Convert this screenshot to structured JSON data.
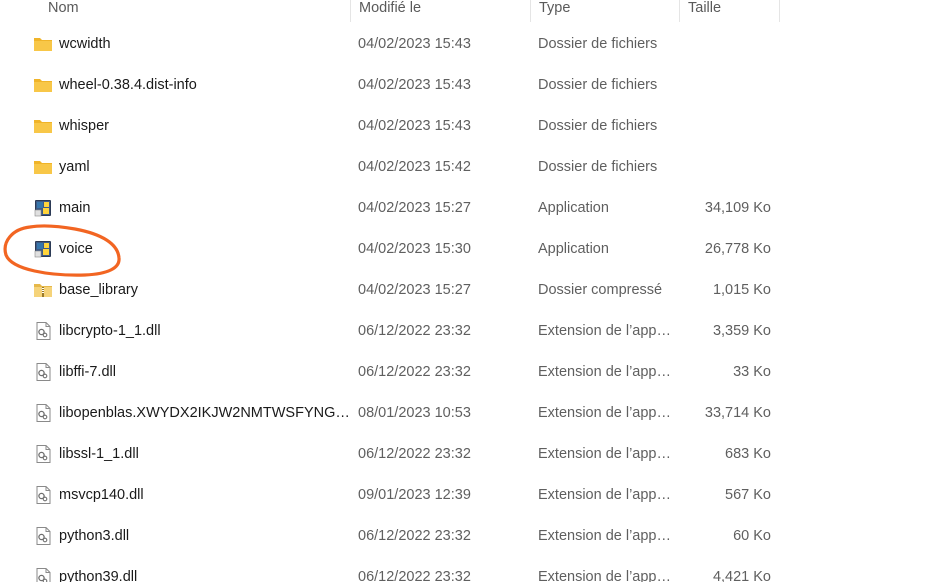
{
  "columns": {
    "name": "Nom",
    "modified": "Modifié le",
    "type": "Type",
    "size": "Taille"
  },
  "files": [
    {
      "name": "wcwidth",
      "modified": "04/02/2023 15:43",
      "type": "Dossier de fichiers",
      "size": "",
      "icon": "folder-icon"
    },
    {
      "name": "wheel-0.38.4.dist-info",
      "modified": "04/02/2023 15:43",
      "type": "Dossier de fichiers",
      "size": "",
      "icon": "folder-icon"
    },
    {
      "name": "whisper",
      "modified": "04/02/2023 15:43",
      "type": "Dossier de fichiers",
      "size": "",
      "icon": "folder-icon"
    },
    {
      "name": "yaml",
      "modified": "04/02/2023 15:42",
      "type": "Dossier de fichiers",
      "size": "",
      "icon": "folder-icon"
    },
    {
      "name": "main",
      "modified": "04/02/2023 15:27",
      "type": "Application",
      "size": "34,109 Ko",
      "icon": "python-app-icon"
    },
    {
      "name": "voice",
      "modified": "04/02/2023 15:30",
      "type": "Application",
      "size": "26,778 Ko",
      "icon": "python-app-icon"
    },
    {
      "name": "base_library",
      "modified": "04/02/2023 15:27",
      "type": "Dossier compressé",
      "size": "1,015 Ko",
      "icon": "zip-folder-icon"
    },
    {
      "name": "libcrypto-1_1.dll",
      "modified": "06/12/2022 23:32",
      "type": "Extension de l’app…",
      "size": "3,359 Ko",
      "icon": "dll-file-icon"
    },
    {
      "name": "libffi-7.dll",
      "modified": "06/12/2022 23:32",
      "type": "Extension de l’app…",
      "size": "33 Ko",
      "icon": "dll-file-icon"
    },
    {
      "name": "libopenblas.XWYDX2IKJW2NMTWSFYNG…",
      "modified": "08/01/2023 10:53",
      "type": "Extension de l’app…",
      "size": "33,714 Ko",
      "icon": "dll-file-icon"
    },
    {
      "name": "libssl-1_1.dll",
      "modified": "06/12/2022 23:32",
      "type": "Extension de l’app…",
      "size": "683 Ko",
      "icon": "dll-file-icon"
    },
    {
      "name": "msvcp140.dll",
      "modified": "09/01/2023 12:39",
      "type": "Extension de l’app…",
      "size": "567 Ko",
      "icon": "dll-file-icon"
    },
    {
      "name": "python3.dll",
      "modified": "06/12/2022 23:32",
      "type": "Extension de l’app…",
      "size": "60 Ko",
      "icon": "dll-file-icon"
    },
    {
      "name": "python39.dll",
      "modified": "06/12/2022 23:32",
      "type": "Extension de l’app…",
      "size": "4,421 Ko",
      "icon": "dll-file-icon"
    }
  ],
  "colors": {
    "annotation": "#f26522",
    "folder": "#f8c748"
  }
}
